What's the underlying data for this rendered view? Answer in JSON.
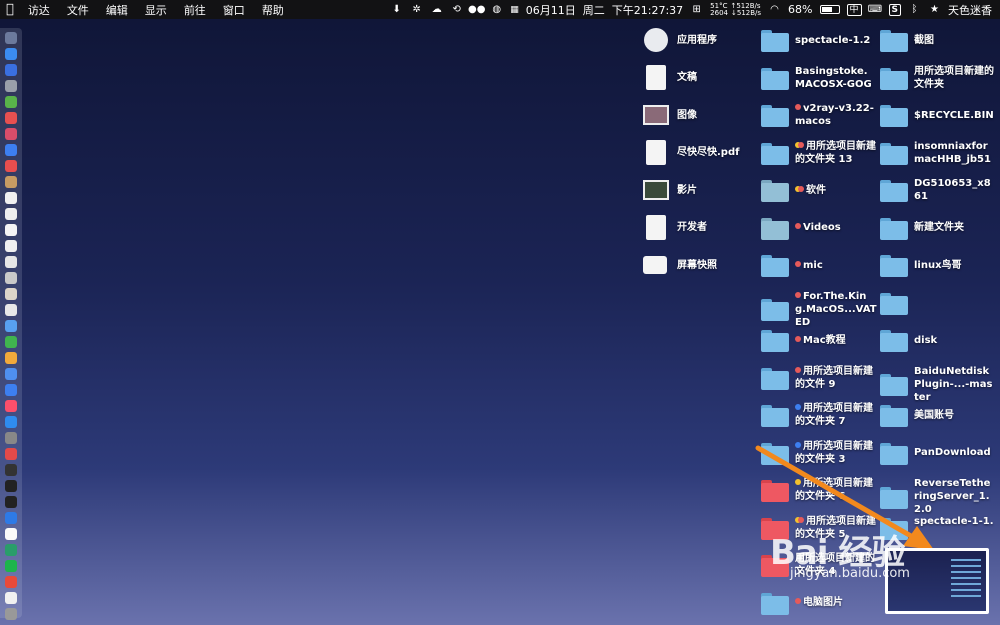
{
  "menubar": {
    "items": [
      "访达",
      "文件",
      "编辑",
      "显示",
      "前往",
      "窗口",
      "帮助"
    ],
    "status": {
      "temperature": "51°C",
      "cpu": "2604",
      "upload": "↑512B/s",
      "download": "↓512B/s",
      "date": "06月11日",
      "weekday": "周二",
      "time": "下午21:27:37",
      "battery": "68%",
      "battery_level": 0.68,
      "input_method": "中",
      "username": "天色迷香"
    }
  },
  "desktop": {
    "col1": [
      {
        "label": "应用程序",
        "icon": "applications-icon"
      },
      {
        "label": "文稿",
        "icon": "document-icon"
      },
      {
        "label": "图像",
        "icon": "image-icon"
      },
      {
        "label": "尽快尽快.pdf",
        "icon": "pdf-icon"
      },
      {
        "label": "影片",
        "icon": "movie-icon"
      },
      {
        "label": "开发者",
        "icon": "document-icon"
      },
      {
        "label": "屏幕快照",
        "icon": "screenshot-icon"
      }
    ],
    "col2": [
      {
        "label": "spectacle-1.2",
        "tags": []
      },
      {
        "label": "Basingstoke.MACOSX-GOG",
        "tags": []
      },
      {
        "label": "v2ray-v3.22-macos",
        "tags": [
          "#e55a5a"
        ]
      },
      {
        "label": "用所选项目新建的文件夹 13",
        "tags": [
          "#f2c12e",
          "#e55a5a"
        ]
      },
      {
        "label": "软件",
        "tags": [
          "#f2c12e",
          "#e55a5a"
        ]
      },
      {
        "label": "Videos",
        "tags": [
          "#e55a5a"
        ]
      },
      {
        "label": "mic",
        "tags": [
          "#e55a5a"
        ]
      },
      {
        "label": "For.The.King.MacOS...VATED",
        "tags": [
          "#e55a5a"
        ]
      },
      {
        "label": "Mac教程",
        "tags": [
          "#e55a5a"
        ]
      },
      {
        "label": "用所选项目新建的文件 9",
        "tags": [
          "#e55a5a"
        ]
      },
      {
        "label": "用所选项目新建的文件夹 7",
        "tags": [
          "#3d7ff0"
        ]
      },
      {
        "label": "用所选项目新建的文件夹 3",
        "tags": [
          "#3d7ff0"
        ]
      },
      {
        "label": "用所选项目新建的文件夹 6",
        "tags": [
          "#f2c12e"
        ]
      },
      {
        "label": "用所选项目新建的文件夹 5",
        "tags": [
          "#f2c12e",
          "#e55a5a"
        ]
      },
      {
        "label": "用所选项目新建的文件夹 4",
        "tags": []
      },
      {
        "label": "电脑图片",
        "tags": [
          "#e55a5a"
        ]
      }
    ],
    "col3": [
      {
        "label": "截图"
      },
      {
        "label": "用所选项目新建的文件夹"
      },
      {
        "label": "$RECYCLE.BIN"
      },
      {
        "label": "insomniaxformacHHB_jb51"
      },
      {
        "label": "DG510653_x861"
      },
      {
        "label": "新建文件夹"
      },
      {
        "label": "linux鸟哥"
      },
      {
        "label": ""
      },
      {
        "label": "disk"
      },
      {
        "label": "BaiduNetdiskPlugin-...-master"
      },
      {
        "label": "美国账号"
      },
      {
        "label": "PanDownload"
      },
      {
        "label": "ReverseTetheringServer_1.2.0"
      },
      {
        "label": "spectacle-1-1.2"
      }
    ]
  },
  "watermark": {
    "text": "Bai 经验",
    "sub": "jingyan.baidu.com"
  }
}
